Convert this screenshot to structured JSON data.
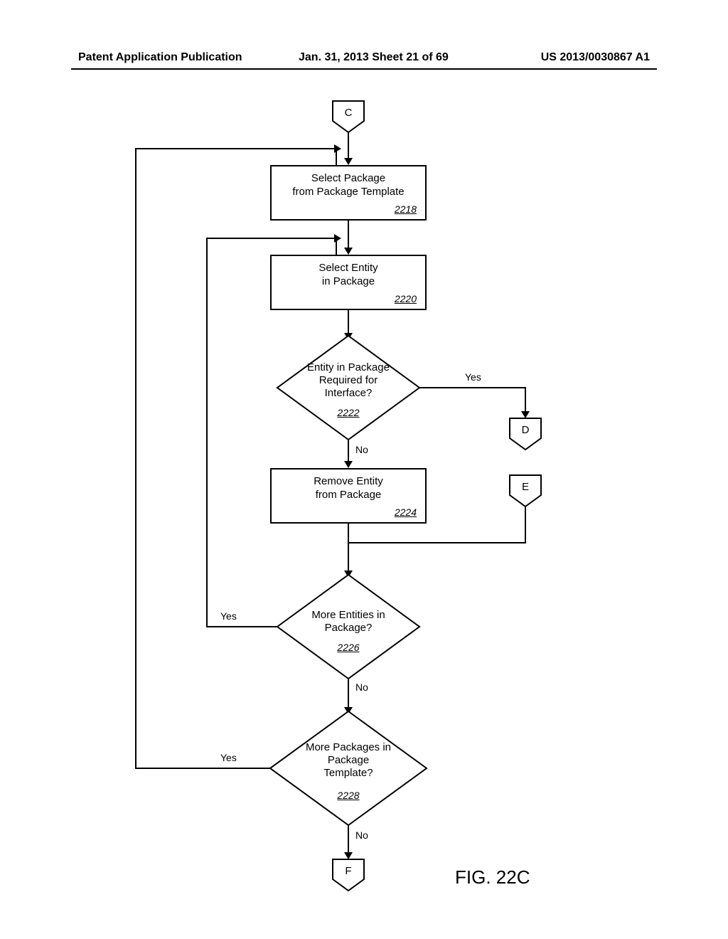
{
  "header": {
    "left": "Patent Application Publication",
    "center": "Jan. 31, 2013  Sheet 21 of 69",
    "right": "US 2013/0030867 A1"
  },
  "connectors": {
    "c": "C",
    "d": "D",
    "e": "E",
    "f": "F"
  },
  "nodes": {
    "p2218": {
      "line1": "Select Package",
      "line2": "from Package Template",
      "ref": "2218"
    },
    "p2220": {
      "line1": "Select Entity",
      "line2": "in Package",
      "ref": "2220"
    },
    "d2222": {
      "line1": "Entity in Package",
      "line2": "Required for",
      "line3": "Interface?",
      "ref": "2222"
    },
    "p2224": {
      "line1": "Remove Entity",
      "line2": "from Package",
      "ref": "2224"
    },
    "d2226": {
      "line1": "More Entities in",
      "line2": "Package?",
      "ref": "2226"
    },
    "d2228": {
      "line1": "More Packages in",
      "line2": "Package",
      "line3": "Template?",
      "ref": "2228"
    }
  },
  "labels": {
    "yes": "Yes",
    "no": "No"
  },
  "figure": "FIG. 22C"
}
